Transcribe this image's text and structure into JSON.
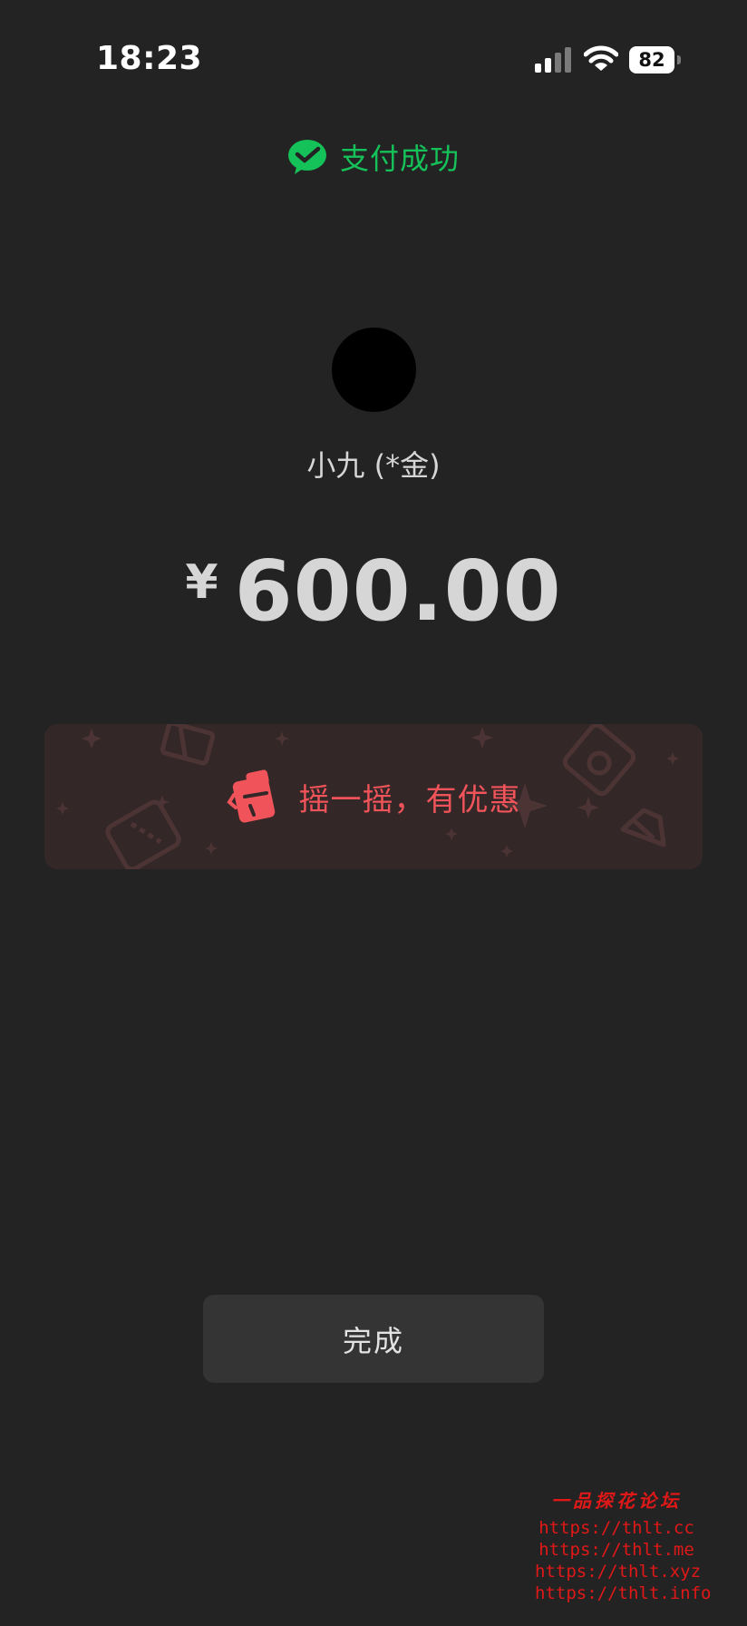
{
  "status_bar": {
    "time": "18:23",
    "battery_level": "82",
    "icons": [
      "signal-icon",
      "wifi-icon",
      "battery-icon"
    ]
  },
  "header": {
    "icon": "wechat-pay-icon",
    "status_text": "支付成功",
    "accent_color": "#15c259"
  },
  "payee": {
    "name": "小九 (*金)"
  },
  "payment": {
    "currency_symbol": "¥",
    "amount": "600.00"
  },
  "promo": {
    "icon": "shake-icon",
    "text": "摇一摇，有优惠",
    "accent_color": "#f0545a"
  },
  "actions": {
    "done_label": "完成"
  },
  "watermark": {
    "title": "一品探花论坛",
    "links": [
      "https://thlt.cc",
      "https://thlt.me",
      "https://thlt.xyz",
      "https://thlt.info"
    ]
  }
}
